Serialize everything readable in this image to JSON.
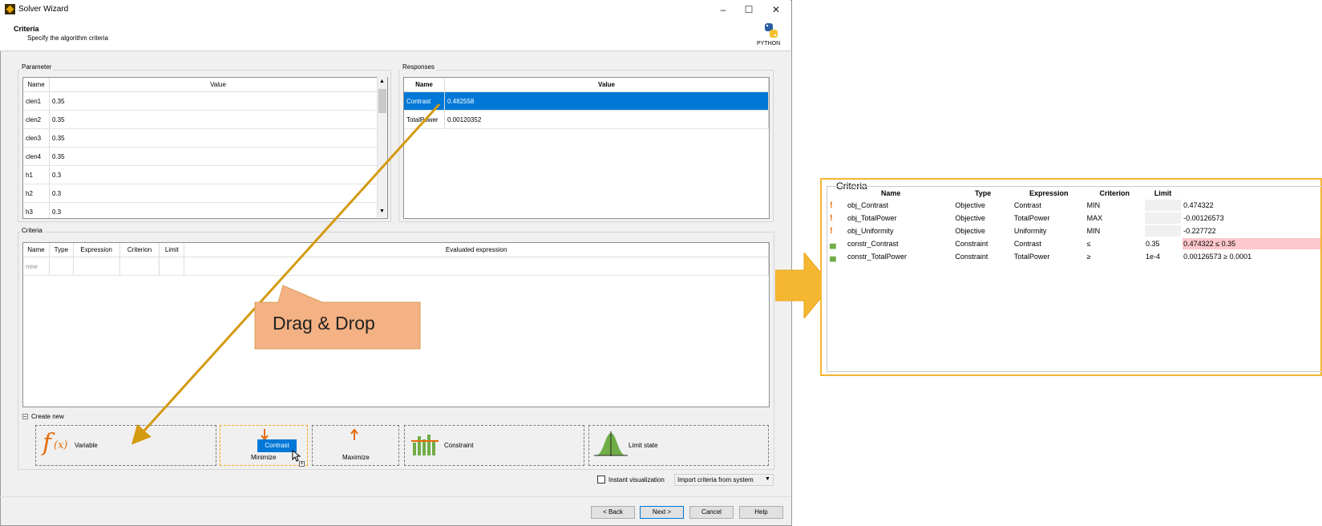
{
  "window": {
    "title": "Solver Wizard"
  },
  "header": {
    "title": "Criteria",
    "subtitle": "Specify the algorithm criteria",
    "logo_label": "PYTHON"
  },
  "parameter": {
    "group_title": "Parameter",
    "columns": [
      "Name",
      "Value"
    ],
    "rows": [
      {
        "name": "clen1",
        "value": "0.35"
      },
      {
        "name": "clen2",
        "value": "0.35"
      },
      {
        "name": "clen3",
        "value": "0.35"
      },
      {
        "name": "clen4",
        "value": "0.35"
      },
      {
        "name": "h1",
        "value": "0.3"
      },
      {
        "name": "h2",
        "value": "0.3"
      },
      {
        "name": "h3",
        "value": "0.3"
      }
    ]
  },
  "responses": {
    "group_title": "Responses",
    "columns": [
      "Name",
      "Value"
    ],
    "rows": [
      {
        "name": "Contrast",
        "value": "0.482558"
      },
      {
        "name": "TotalPower",
        "value": "0.00120352"
      }
    ]
  },
  "criteria": {
    "group_title": "Criteria",
    "columns": [
      "Name",
      "Type",
      "Expression",
      "Criterion",
      "Limit",
      "Evaluated expression"
    ],
    "new_placeholder": "new"
  },
  "create_new": {
    "label": "Create new",
    "tiles": {
      "variable": "Variable",
      "minimize": "Minimize",
      "maximize": "Maximize",
      "constraint": "Constraint",
      "limit_state": "Limit state"
    },
    "drag_chip": "Contrast"
  },
  "options": {
    "instant_visualization": "Instant visualization",
    "import_dropdown": "Import criteria from system"
  },
  "footer": {
    "back": "< Back",
    "next": "Next >",
    "cancel": "Cancel",
    "help": "Help"
  },
  "callout": {
    "text": "Drag & Drop"
  },
  "zoom": {
    "title": "Criteria",
    "columns": [
      "Name",
      "Type",
      "Expression",
      "Criterion",
      "Limit",
      ""
    ],
    "rows": [
      {
        "icon": "objective-icon",
        "name": "obj_Contrast",
        "type": "Objective",
        "expression": "Contrast",
        "criterion": "MIN",
        "limit": "",
        "evaluated": "0.474322",
        "violated": false
      },
      {
        "icon": "objective-icon",
        "name": "obj_TotalPower",
        "type": "Objective",
        "expression": "TotalPower",
        "criterion": "MAX",
        "limit": "",
        "evaluated": "-0.00126573",
        "violated": false
      },
      {
        "icon": "objective-icon",
        "name": "obj_Uniformity",
        "type": "Objective",
        "expression": "Uniformity",
        "criterion": "MIN",
        "limit": "",
        "evaluated": "-0.227722",
        "violated": false
      },
      {
        "icon": "constraint-icon",
        "name": "constr_Contrast",
        "type": "Constraint",
        "expression": "Contrast",
        "criterion": "≤",
        "limit": "0.35",
        "evaluated": "0.474322 ≤ 0.35",
        "violated": true
      },
      {
        "icon": "constraint-icon",
        "name": "constr_TotalPower",
        "type": "Constraint",
        "expression": "TotalPower",
        "criterion": "≥",
        "limit": "1e-4",
        "evaluated": "0.00126573 ≥ 0.0001",
        "violated": false
      }
    ]
  },
  "colors": {
    "accent": "#f5b731",
    "selection": "#0078d7",
    "arrow": "#d49a10",
    "callout": "#f4b183",
    "violation": "#ffc7ce"
  }
}
